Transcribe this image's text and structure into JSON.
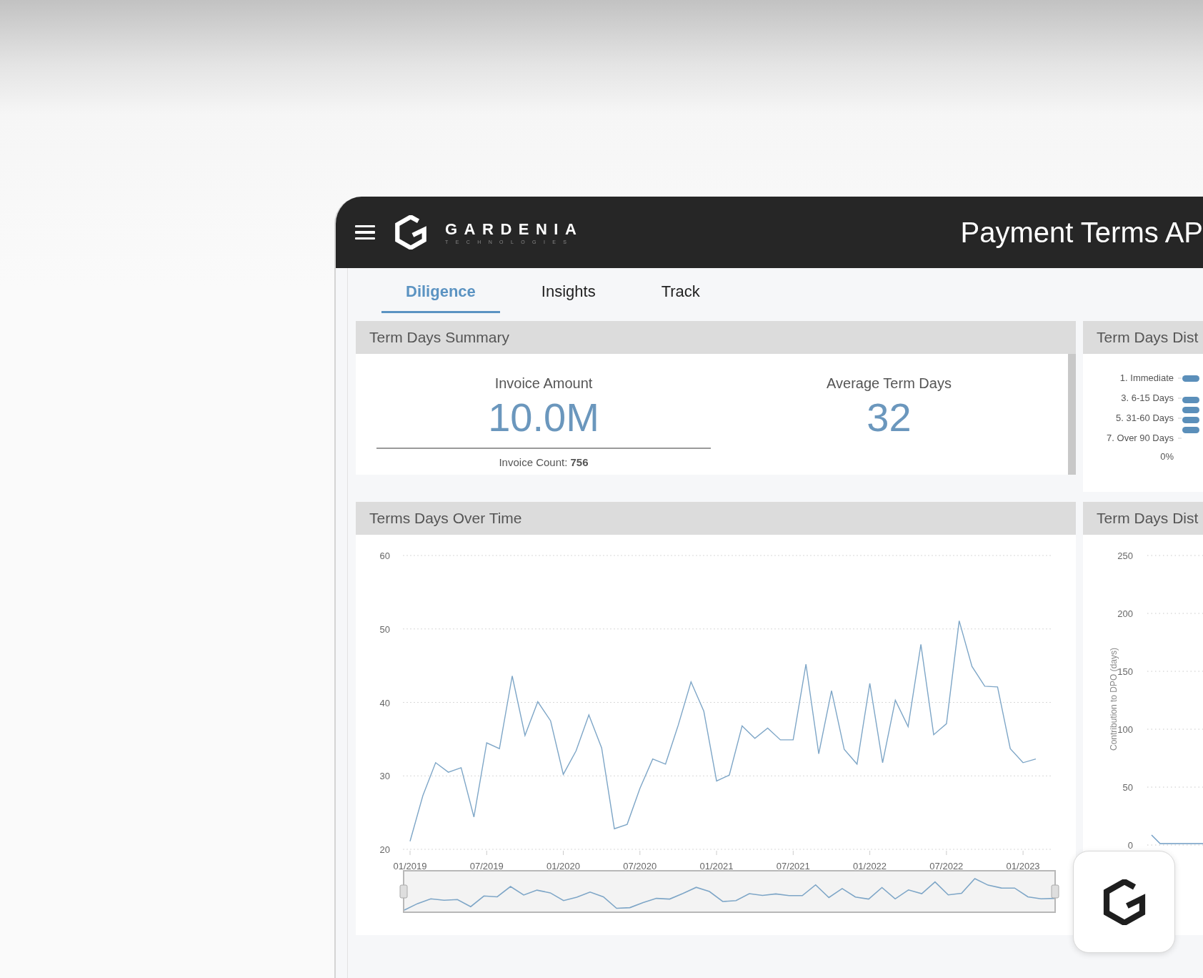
{
  "header": {
    "brand": "GARDENIA",
    "brand_sub": "TECHNOLOGIES",
    "title": "Payment Terms AP"
  },
  "tabs": [
    {
      "label": "Diligence",
      "selected": true
    },
    {
      "label": "Insights",
      "selected": false
    },
    {
      "label": "Track",
      "selected": false
    }
  ],
  "summary": {
    "title": "Term Days Summary",
    "metrics": [
      {
        "label": "Invoice Amount",
        "value": "10.0M",
        "note": "Invoice Count: **756**"
      },
      {
        "label": "Average Term Days",
        "value": "32"
      }
    ]
  },
  "distribution": {
    "title": "Term Days Dist",
    "labels": [
      "1. Immediate",
      "3. 6-15 Days",
      "5. 31-60 Days",
      "7. Over 90 Days"
    ],
    "axis_label": "0%"
  },
  "over_time": {
    "title": "Terms Days Over Time",
    "chart_data": {
      "type": "line",
      "categories": [
        "01/2019",
        null,
        null,
        null,
        null,
        null,
        "07/2019",
        null,
        null,
        null,
        null,
        null,
        "01/2020",
        null,
        null,
        null,
        null,
        null,
        "07/2020",
        null,
        null,
        null,
        null,
        null,
        "01/2021",
        null,
        null,
        null,
        null,
        null,
        "07/2021",
        null,
        null,
        null,
        null,
        null,
        "01/2022",
        null,
        null,
        null,
        null,
        null,
        "07/2022",
        null,
        null,
        null,
        null,
        null,
        "01/2023",
        null
      ],
      "series": [
        {
          "color": "#7ea6c7",
          "values": [
            21.1,
            27.3,
            31.8,
            30.5,
            31.1,
            24.4,
            34.5,
            33.7,
            43.6,
            35.5,
            40.1,
            37.5,
            30.2,
            33.4,
            38.3,
            33.8,
            22.8,
            23.4,
            28.3,
            32.3,
            31.6,
            36.9,
            42.8,
            38.8,
            29.3,
            30.1,
            36.8,
            35.1,
            36.5,
            34.9,
            34.9,
            45.2,
            33.0,
            41.6,
            33.6,
            31.6,
            42.6,
            31.8,
            40.3,
            36.7,
            47.9,
            35.6,
            37.1,
            51.1,
            44.9,
            42.2,
            42.1,
            33.7,
            31.8,
            32.3
          ]
        }
      ],
      "ylim": [
        20,
        60
      ],
      "yticks": [
        20,
        30,
        40,
        50,
        60
      ],
      "grid": true
    }
  },
  "dpo": {
    "title": "Term Days Dist",
    "ylabel": "Contribution to DPO (days)",
    "yticks": [
      "250",
      "200",
      "150",
      "100",
      "50",
      "0"
    ]
  }
}
